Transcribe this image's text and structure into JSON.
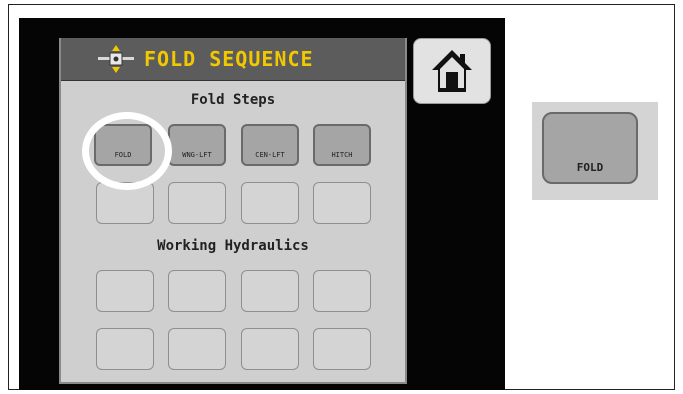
{
  "header": {
    "title": "FOLD SEQUENCE",
    "icon": "implement-fold-icon"
  },
  "home": {
    "icon": "home-icon"
  },
  "fold_steps": {
    "title": "Fold Steps",
    "row1": [
      "FOLD",
      "WNG-LFT",
      "CEN-LFT",
      "HITCH"
    ]
  },
  "working_hydraulics": {
    "title": "Working Hydraulics"
  },
  "zoom": {
    "label": "FOLD"
  },
  "colors": {
    "accent": "#f2c800",
    "header_bg": "#5c5c5c",
    "button": "#a5a5a5"
  }
}
